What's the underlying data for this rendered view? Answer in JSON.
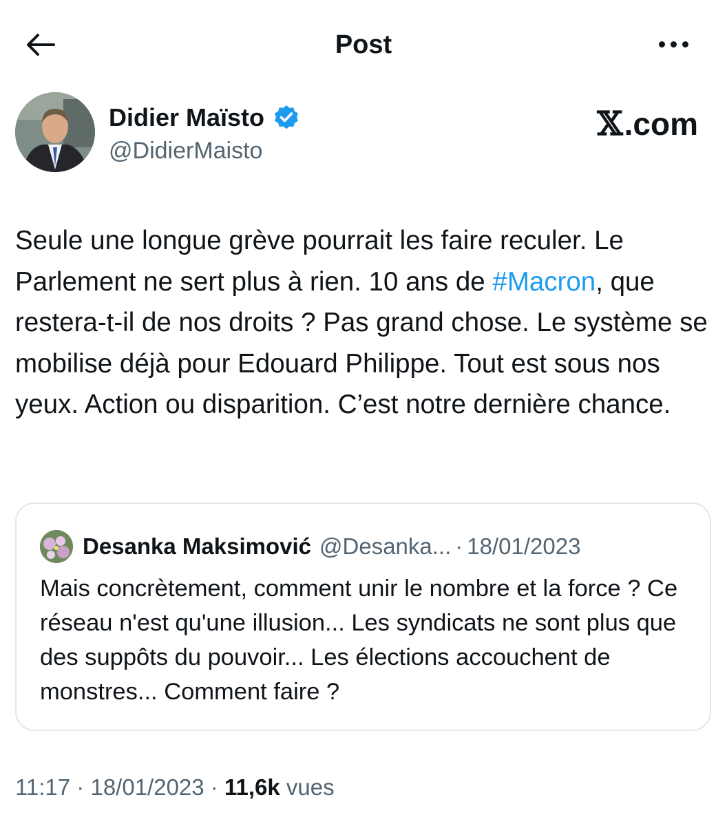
{
  "header": {
    "title": "Post",
    "back_icon": "arrow-left-icon",
    "more_icon": "more-horizontal-icon"
  },
  "tweet": {
    "author_name": "Didier Maïsto",
    "author_handle": "@DidierMaisto",
    "verified_icon": "verified-badge-icon",
    "verified_color": "#1d9bf0",
    "text_before_hashtag": "Seule une longue grève pourrait les faire reculer. Le Parlement ne sert plus à rien. 10 ans de ",
    "hashtag": "#Macron",
    "text_after_hashtag": ", que restera-t-il de nos droits ? Pas grand chose. Le système se mobilise déjà pour Edouard Philippe. Tout est sous nos yeux. Action ou disparition. C’est notre dernière chance."
  },
  "watermark": {
    "x_glyph": "𝕏",
    "text": ".com"
  },
  "quote": {
    "author_name": "Desanka Maksimović",
    "author_handle": "@Desanka...",
    "separator": "·",
    "date": "18/01/2023",
    "text": "Mais concrètement, comment unir le nombre et la force ? Ce réseau n'est qu'une illusion... Les syndicats ne sont plus que des suppôts du pouvoir... Les élections accouchent de monstres... Comment faire ?"
  },
  "meta": {
    "time": "11:17",
    "sep1": " · ",
    "date": "18/01/2023",
    "sep2": " · ",
    "views_count": "11,6k",
    "views_label": " vues"
  },
  "colors": {
    "text": "#0f1419",
    "secondary": "#536471",
    "link": "#1d9bf0",
    "border": "#e3e7ea"
  }
}
